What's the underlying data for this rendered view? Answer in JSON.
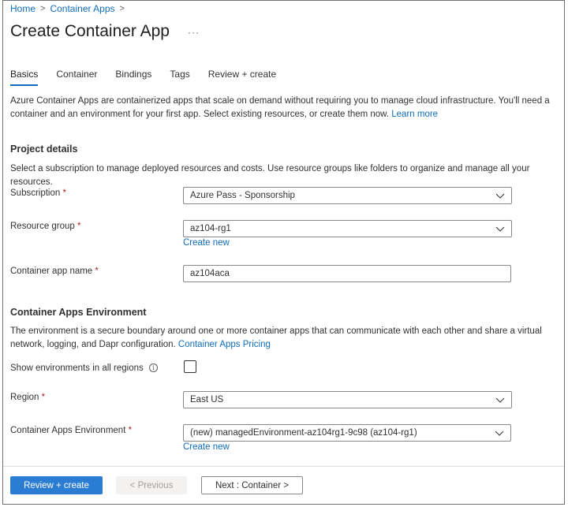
{
  "breadcrumb": {
    "home": "Home",
    "sep": ">",
    "container_apps": "Container Apps"
  },
  "page_title": "Create Container App",
  "more_label": "···",
  "tabs": [
    "Basics",
    "Container",
    "Bindings",
    "Tags",
    "Review + create"
  ],
  "intro": {
    "text": "Azure Container Apps are containerized apps that scale on demand without requiring you to manage cloud infrastructure. You'll need a container and an environment for your first app. Select existing resources, or create them now.",
    "link": "Learn more"
  },
  "project_details": {
    "heading": "Project details",
    "description": "Select a subscription to manage deployed resources and costs. Use resource groups like folders to organize and manage all your resources."
  },
  "form": {
    "subscription": {
      "label": "Subscription",
      "value": "Azure Pass - Sponsorship"
    },
    "resource_group": {
      "label": "Resource group",
      "value": "az104-rg1",
      "create_new": "Create new"
    },
    "app_name": {
      "label": "Container app name",
      "value": "az104aca"
    }
  },
  "environment_section": {
    "heading": "Container Apps Environment",
    "description": "The environment is a secure boundary around one or more container apps that can communicate with each other and share a virtual network, logging, and Dapr configuration.",
    "link": "Container Apps Pricing",
    "show_all_regions": {
      "label": "Show environments in all regions",
      "checked": false
    },
    "region": {
      "label": "Region",
      "value": "East US"
    },
    "environment": {
      "label": "Container Apps Environment",
      "value": "(new) managedEnvironment-az104rg1-9c98 (az104-rg1)",
      "create_new": "Create new"
    }
  },
  "required_mark": "*",
  "info_glyph": "i",
  "footer": {
    "review_create": "Review + create",
    "previous": "< Previous",
    "next": "Next : Container >"
  },
  "colors": {
    "accent": "#0f6cbd",
    "primary_button": "#2b7cd3",
    "required": "#a4262c"
  }
}
